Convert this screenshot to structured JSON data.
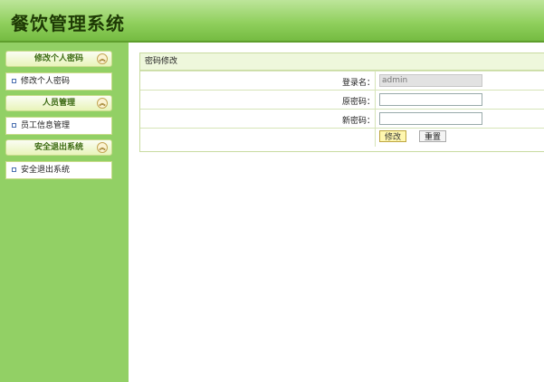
{
  "app": {
    "title": "餐饮管理系统"
  },
  "sidebar": {
    "sections": [
      {
        "title": "修改个人密码",
        "items": [
          "修改个人密码"
        ]
      },
      {
        "title": "人员管理",
        "items": [
          "员工信息管理"
        ]
      },
      {
        "title": "安全退出系统",
        "items": [
          "安全退出系统"
        ]
      }
    ]
  },
  "form": {
    "title": "密码修改",
    "username_label": "登录名：",
    "username_value": "admin",
    "old_password_label": "原密码：",
    "new_password_label": "新密码：",
    "submit_label": "修改",
    "reset_label": "重置"
  },
  "colors": {
    "header": "#8fcf5c",
    "sidebar": "#92d065",
    "accent": "#3b6a12"
  },
  "icons": {
    "collapse": "chevron-up-icon",
    "bullet": "square-bullet-icon"
  }
}
